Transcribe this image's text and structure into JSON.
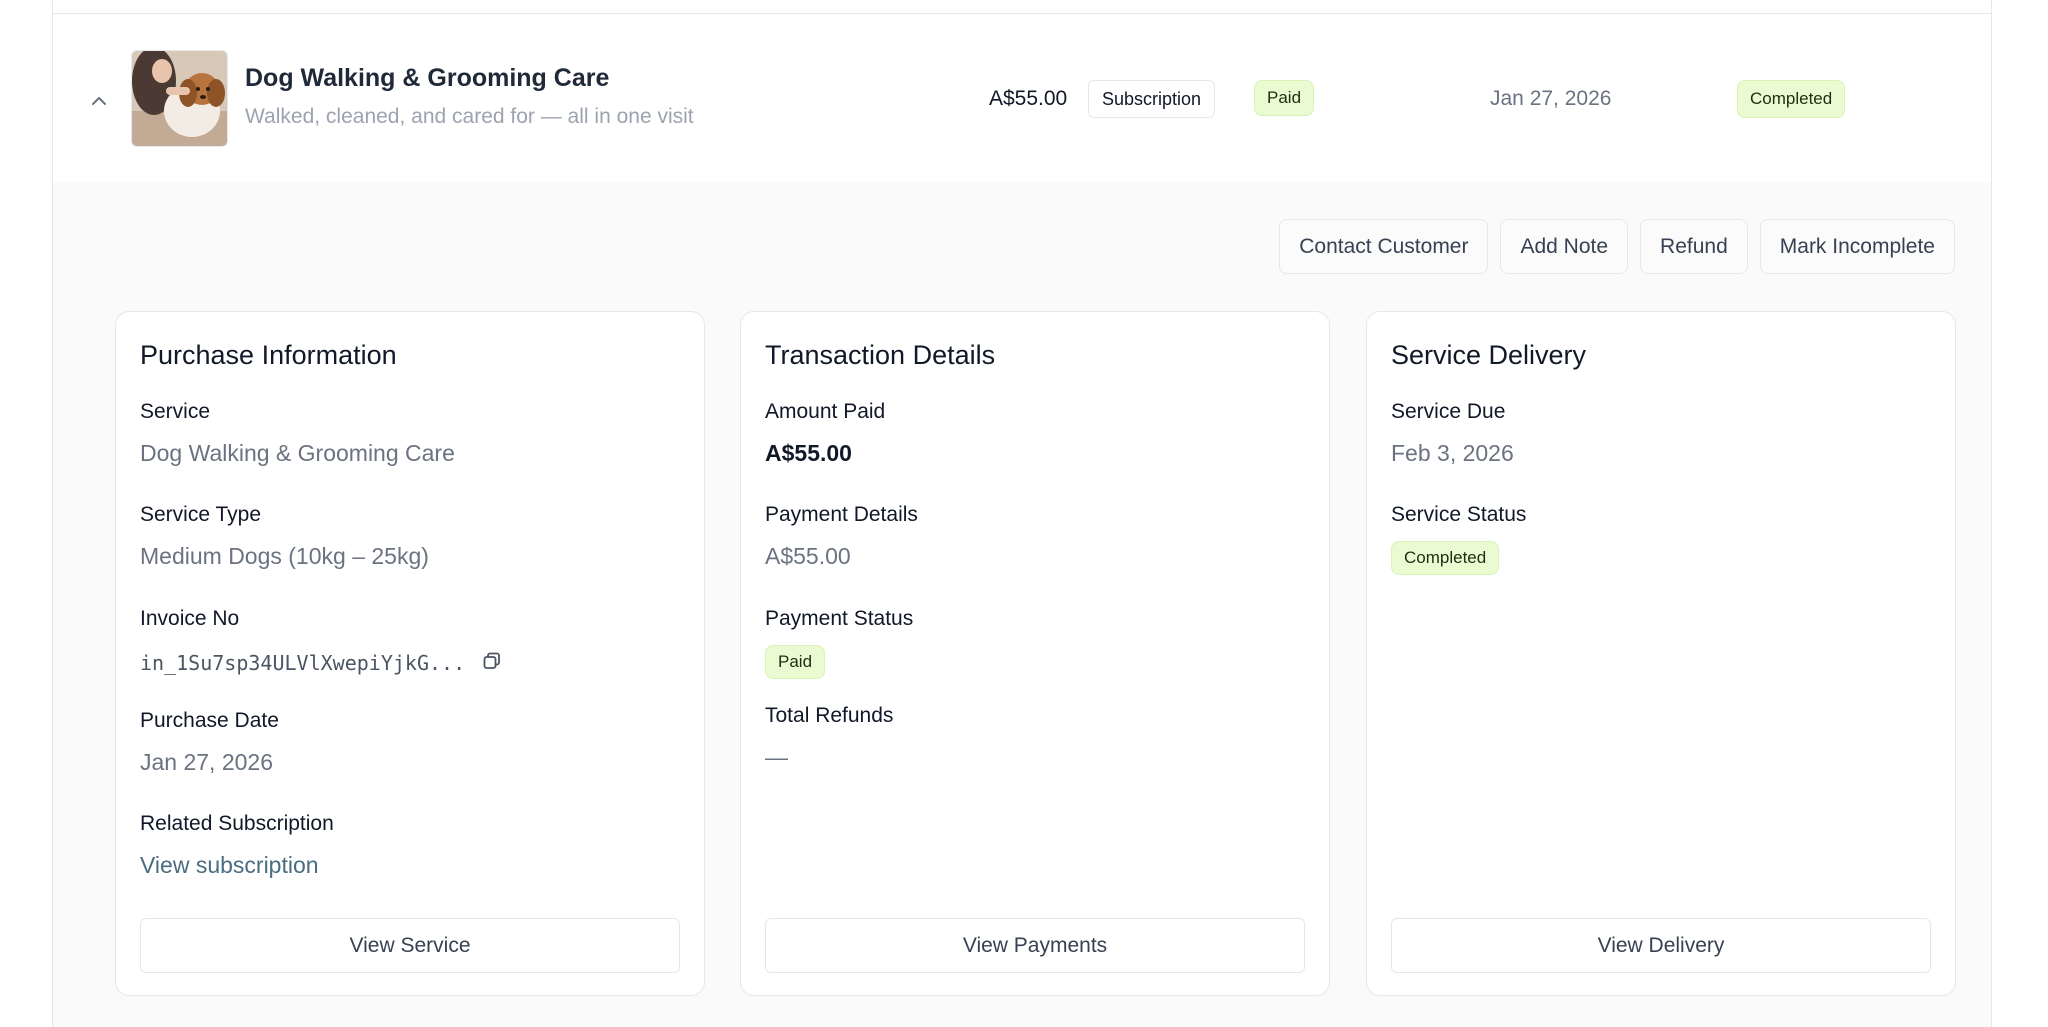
{
  "row": {
    "title": "Dog Walking & Grooming Care",
    "subtitle": "Walked, cleaned, and cared for — all in one visit",
    "amount": "A$55.00",
    "type": "Subscription",
    "payment_status": "Paid",
    "date": "Jan 27, 2026",
    "status": "Completed",
    "thumbnail_icon": "dog-grooming-photo"
  },
  "actions": {
    "contact": "Contact Customer",
    "note": "Add Note",
    "refund": "Refund",
    "incomplete": "Mark Incomplete"
  },
  "purchase": {
    "title": "Purchase Information",
    "service_label": "Service",
    "service_value": "Dog Walking & Grooming Care",
    "type_label": "Service Type",
    "type_value": "Medium Dogs (10kg – 25kg)",
    "invoice_label": "Invoice No",
    "invoice_value": "in_1Su7sp34ULVlXwepiYjkG...",
    "date_label": "Purchase Date",
    "date_value": "Jan 27, 2026",
    "related_label": "Related Subscription",
    "related_link": "View subscription",
    "button": "View Service"
  },
  "transaction": {
    "title": "Transaction Details",
    "amount_label": "Amount Paid",
    "amount_value": "A$55.00",
    "details_label": "Payment Details",
    "details_value": "A$55.00",
    "status_label": "Payment Status",
    "status_value": "Paid",
    "refunds_label": "Total Refunds",
    "refunds_value": "—",
    "button": "View Payments"
  },
  "delivery": {
    "title": "Service Delivery",
    "due_label": "Service Due",
    "due_value": "Feb 3, 2026",
    "status_label": "Service Status",
    "status_value": "Completed",
    "button": "View Delivery"
  },
  "colors": {
    "badge_bg": "#eafbd2",
    "link": "#4a6c80",
    "panel_bg": "#fafafa"
  }
}
